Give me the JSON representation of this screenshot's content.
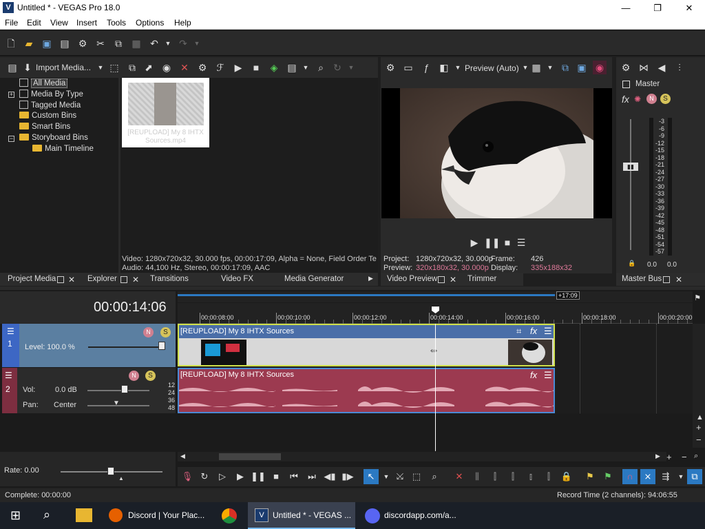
{
  "window": {
    "title": "Untitled * - VEGAS Pro 18.0",
    "app_icon": "V"
  },
  "menu": [
    "File",
    "Edit",
    "View",
    "Insert",
    "Tools",
    "Options",
    "Help"
  ],
  "project_media": {
    "import_label": "Import Media...",
    "tree": [
      {
        "label": "All Media",
        "selected": true
      },
      {
        "label": "Media By Type"
      },
      {
        "label": "Tagged Media"
      },
      {
        "label": "Custom Bins"
      },
      {
        "label": "Smart Bins"
      },
      {
        "label": "Storyboard Bins"
      },
      {
        "label": "Main Timeline"
      }
    ],
    "thumb_caption": "[REUPLOAD] My 8 IHTX Sources.mp4",
    "info_video": "Video: 1280x720x32, 30.000 fps, 00:00:17:09, Alpha = None, Field Order Te",
    "info_audio": "Audio: 44,100 Hz, Stereo, 00:00:17:09, AAC",
    "tabs": [
      "Project Media",
      "Explorer",
      "Transitions",
      "Video FX",
      "Media Generator"
    ]
  },
  "preview": {
    "mode": "Preview (Auto)",
    "project_label": "Project:",
    "project_value": "1280x720x32, 30.000p",
    "frame_label": "Frame:",
    "frame_value": "426",
    "preview_label": "Preview:",
    "preview_value": "320x180x32, 30.000p",
    "display_label": "Display:",
    "display_value": "335x188x32",
    "tabs": [
      "Video Preview",
      "Trimmer"
    ]
  },
  "master": {
    "label": "Master",
    "scale": [
      "3",
      "6",
      "9",
      "12",
      "15",
      "18",
      "21",
      "24",
      "27",
      "30",
      "33",
      "36",
      "39",
      "42",
      "45",
      "48",
      "51",
      "54",
      "57"
    ],
    "left_val": "0.0",
    "right_val": "0.0",
    "tab": "Master Bus"
  },
  "timeline": {
    "timecode": "00:00:14:06",
    "end_marker": "+17:09",
    "ruler": [
      "00:00:08:00",
      "00:00:10:00",
      "00:00:12:00",
      "00:00:14:00",
      "00:00:16:00",
      "00:00:18:00",
      "00:00:20:00"
    ],
    "video_track": {
      "num": "1",
      "level_label": "Level: 100.0 %",
      "clip": "[REUPLOAD] My 8 IHTX Sources"
    },
    "audio_track": {
      "num": "2",
      "vol_label": "Vol:",
      "vol_value": "0.0 dB",
      "pan_label": "Pan:",
      "pan_value": "Center",
      "db_scale": [
        "12",
        "24",
        "36",
        "48"
      ],
      "clip": "[REUPLOAD] My 8 IHTX Sources"
    },
    "rate_label": "Rate: 0.00"
  },
  "status": {
    "left": "Complete: 00:00:00",
    "right": "Record Time (2 channels): 94:06:55"
  },
  "taskbar": [
    {
      "label": "Discord | Your Plac..."
    },
    {
      "label": "Untitled * - VEGAS ..."
    },
    {
      "label": "discordapp.com/a..."
    }
  ],
  "colors": {
    "accent": "#2b79c2",
    "video_track": "#4a6ea8",
    "audio_track": "#9c3a50",
    "track_header_video": "#5b7fa1",
    "track_header_audio": "#7d2e40"
  }
}
